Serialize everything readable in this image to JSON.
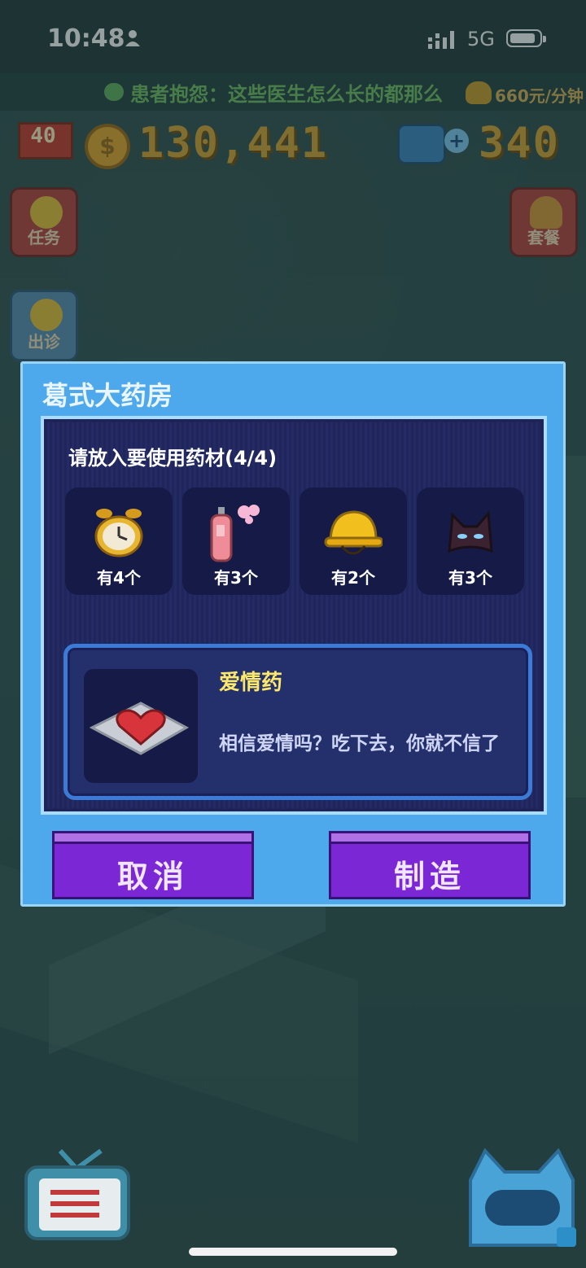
{
  "status_bar": {
    "time": "10:48",
    "network": "5G"
  },
  "ticker": {
    "message": "患者抱怨：这些医生怎么长的都那么",
    "rate": "660元/分钟"
  },
  "hud": {
    "level": "40",
    "coins": "130,441",
    "gems": "340"
  },
  "side_buttons": {
    "tasks": "任务",
    "house_call": "出诊",
    "meal": "套餐"
  },
  "dialog": {
    "title": "葛式大药房",
    "prompt": "请放入要使用药材(4/4)",
    "ingredients": [
      {
        "icon": "alarm-clock-icon",
        "qty": "有4个"
      },
      {
        "icon": "perfume-bottle-icon",
        "qty": "有3个"
      },
      {
        "icon": "hard-hat-icon",
        "qty": "有2个"
      },
      {
        "icon": "bat-mask-icon",
        "qty": "有3个"
      }
    ],
    "recipe": {
      "icon": "heart-pill-icon",
      "name": "爱情药",
      "description": "相信爱情吗？吃下去，你就不信了"
    },
    "cancel_label": "取消",
    "make_label": "制造"
  },
  "colors": {
    "dialog_bg": "#4ea8ec",
    "panel_bg": "#1e2458",
    "button": "#7b27d6",
    "title_yellow": "#fbe86c",
    "coin_gold": "#d6a434"
  }
}
